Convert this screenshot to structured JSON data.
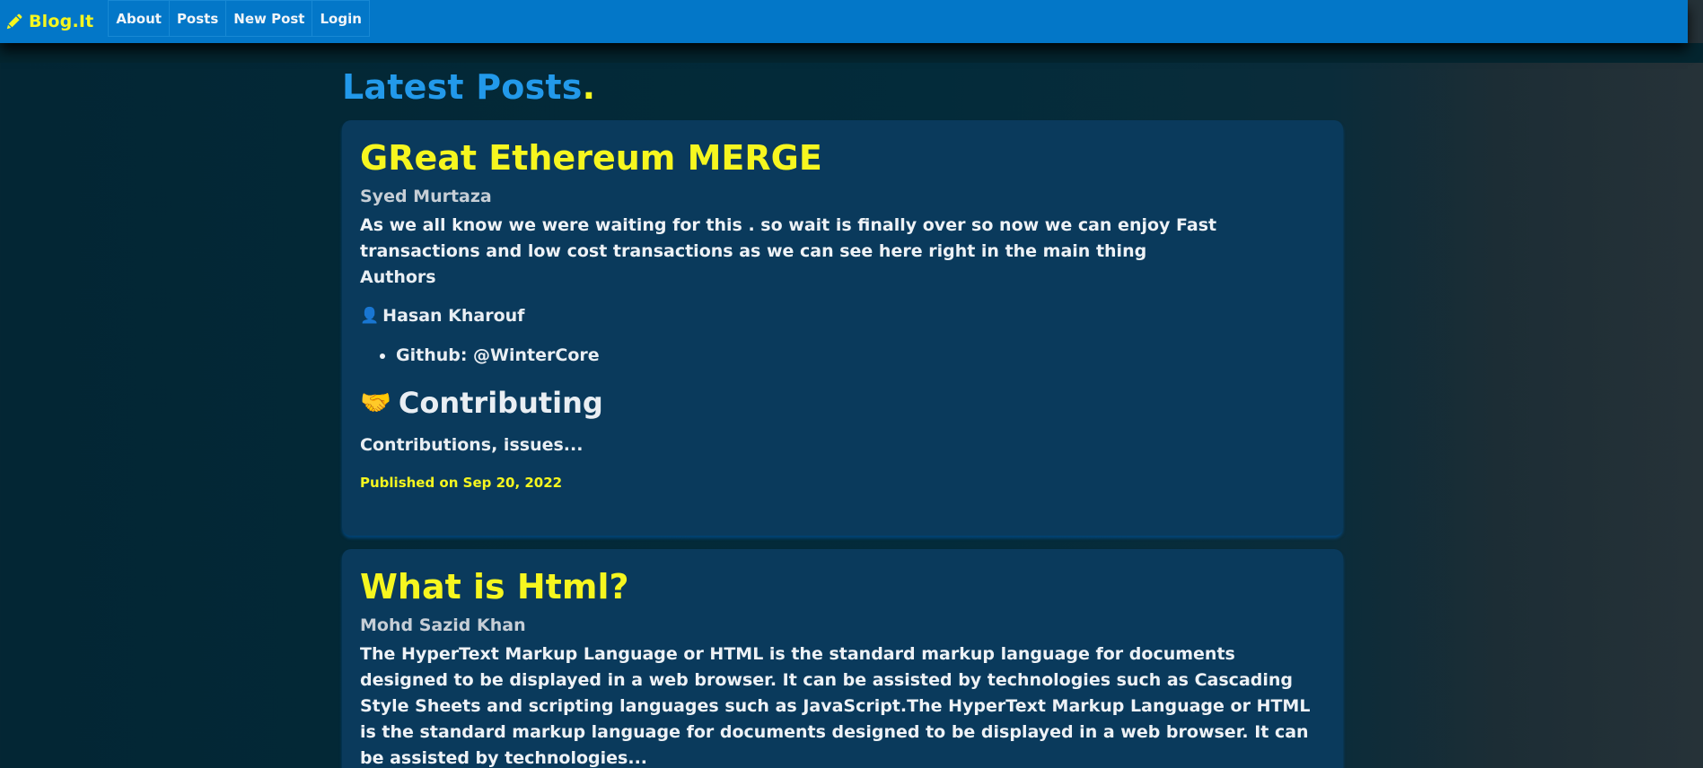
{
  "navbar": {
    "brand": "Blog.It",
    "items": [
      "About",
      "Posts",
      "New Post",
      "Login"
    ]
  },
  "main": {
    "title": "Latest Posts",
    "title_dot": "."
  },
  "posts": [
    {
      "title": "GReat Ethereum MERGE",
      "author": "Syed Murtaza",
      "body": "As we all know we were waiting for this . so wait is finally over so now we can enjoy Fast transactions and low cost transactions as we can see here right in the main thing",
      "authors_label": "Authors",
      "author_person": "Hasan Kharouf",
      "github": "Github: @WinterCore",
      "contributing_heading": "Contributing",
      "contributing_text": "Contributions, issues...",
      "published": "Published on Sep 20, 2022"
    },
    {
      "title": "What is Html?",
      "author": "Mohd Sazid Khan",
      "body": "The HyperText Markup Language or HTML is the standard markup language for documents designed to be displayed in a web browser. It can be assisted by technologies such as Cascading Style Sheets and scripting languages such as JavaScript.The HyperText Markup Language or HTML is the standard markup language for documents designed to be displayed in a web browser. It can be assisted by technologies..."
    }
  ],
  "icons": {
    "brand": "pencil-icon",
    "person": "person-icon",
    "contributing": "handshake-icon"
  },
  "colors": {
    "navbar": "#0377c8",
    "accent_yellow": "#f6f61f",
    "title_blue": "#2299ea",
    "card": "#0a3a5c",
    "background": "#032634"
  }
}
